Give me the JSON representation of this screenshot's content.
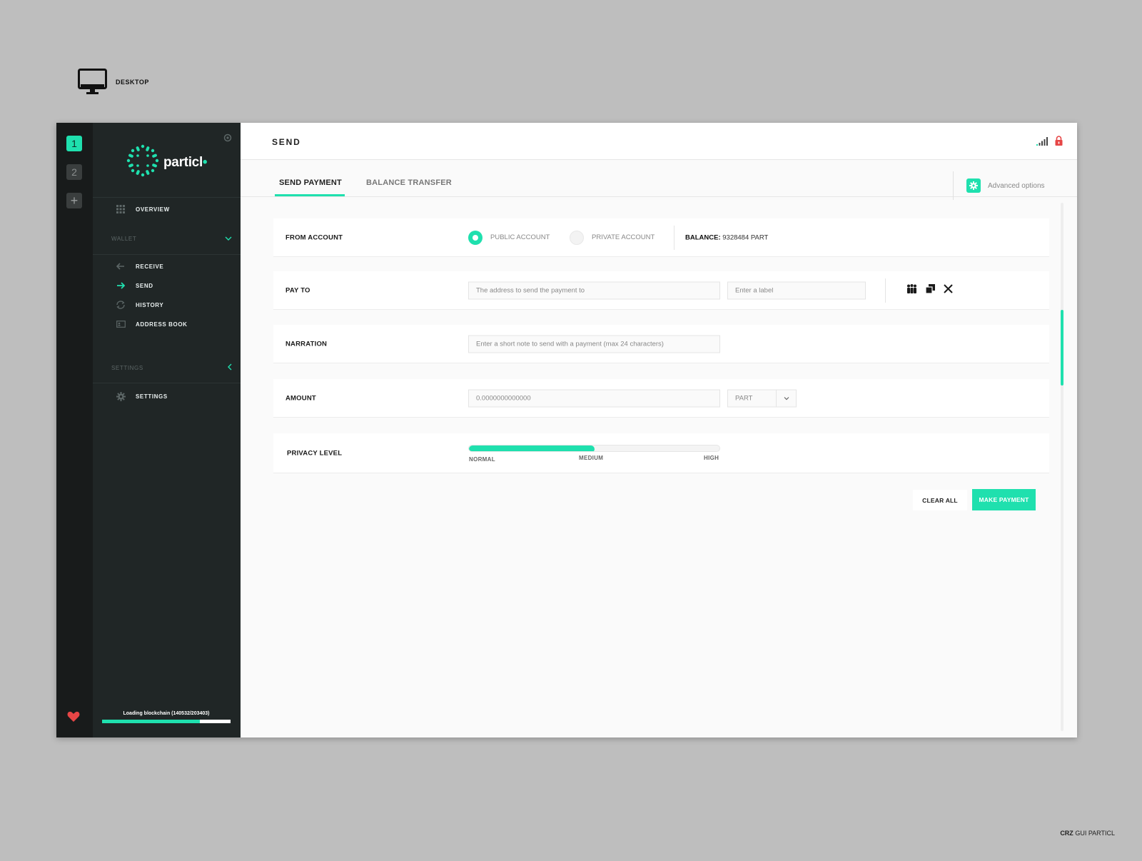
{
  "device": {
    "label": "DESKTOP"
  },
  "workspaces": [
    "1",
    "2",
    "+"
  ],
  "brand": {
    "name": "particl",
    "dot": "•"
  },
  "sidebar": {
    "overview": "OVERVIEW",
    "wallet_section": "WALLET",
    "wallet_items": [
      {
        "label": "RECEIVE",
        "icon": "arrow-left-icon"
      },
      {
        "label": "SEND",
        "icon": "arrow-right-icon",
        "active": true
      },
      {
        "label": "HISTORY",
        "icon": "history-icon"
      },
      {
        "label": "ADDRESS BOOK",
        "icon": "address-book-icon"
      }
    ],
    "settings_section": "SETTINGS",
    "settings_item": "SETTINGS",
    "sync_label": "Loading blockchain (140532/203403)",
    "sync_progress": 0.76
  },
  "header": {
    "title": "SEND"
  },
  "tabs": [
    {
      "label": "SEND PAYMENT",
      "active": true
    },
    {
      "label": "BALANCE TRANSFER",
      "active": false
    }
  ],
  "advanced_options": "Advanced options",
  "form": {
    "from_account": {
      "label": "FROM ACCOUNT",
      "options": [
        "PUBLIC ACCOUNT",
        "PRIVATE ACCOUNT"
      ],
      "selected": "PUBLIC ACCOUNT",
      "balance_label": "BALANCE:",
      "balance_value": "9328484 PART"
    },
    "pay_to": {
      "label": "PAY TO",
      "address_placeholder": "The address to send the payment to",
      "label_placeholder": "Enter a label"
    },
    "narration": {
      "label": "NARRATION",
      "placeholder": "Enter a short note to send with a payment (max 24 characters)"
    },
    "amount": {
      "label": "AMOUNT",
      "value": "0.0000000000000",
      "currency": "PART"
    },
    "privacy": {
      "label": "PRIVACY LEVEL",
      "levels": [
        "NORMAL",
        "MEDIUM",
        "HIGH"
      ],
      "level": 0.5
    }
  },
  "actions": {
    "clear": "CLEAR ALL",
    "pay": "MAKE PAYMENT"
  },
  "credit": {
    "bold": "CRZ",
    "rest": " GUI PARTICL"
  },
  "colors": {
    "accent": "#1fe0ae",
    "sidebar": "#202626",
    "strip": "#181b1b",
    "lock": "#e64646"
  }
}
